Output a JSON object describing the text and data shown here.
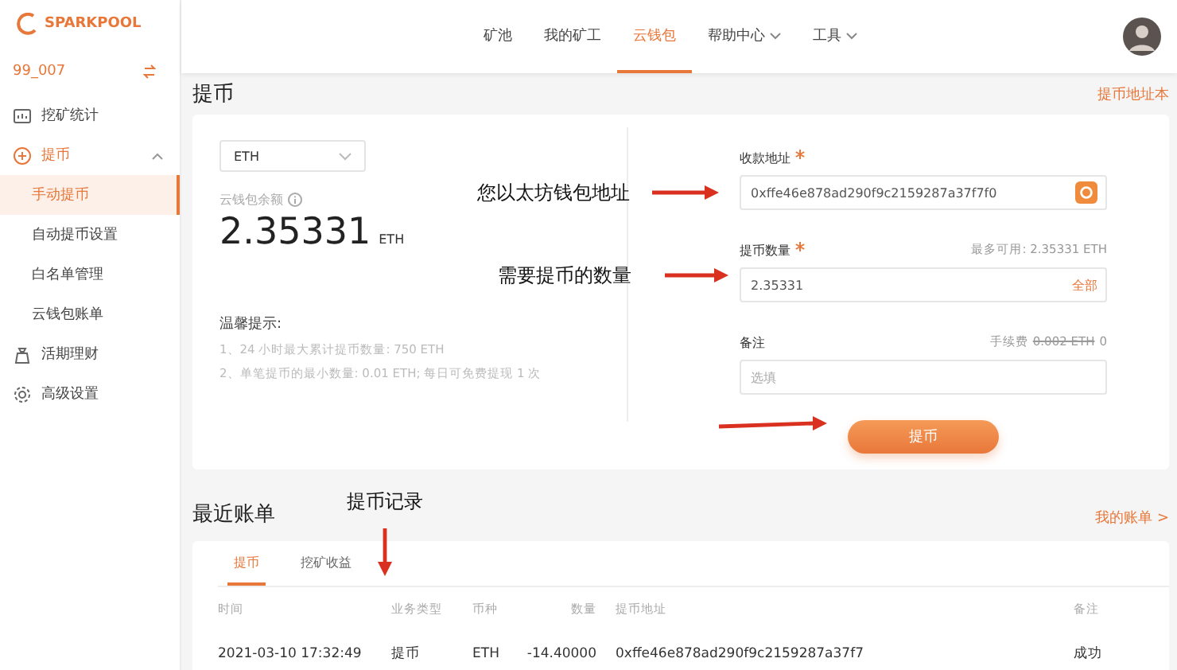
{
  "sidebar": {
    "logo": "SPARKPOOL",
    "user": "99_007",
    "items": [
      {
        "label": "挖矿统计"
      },
      {
        "label": "提币",
        "expanded": true,
        "children": [
          {
            "label": "手动提币",
            "selected": true
          },
          {
            "label": "自动提币设置",
            "selected": false
          },
          {
            "label": "白名单管理",
            "selected": false
          },
          {
            "label": "云钱包账单",
            "selected": false
          }
        ]
      },
      {
        "label": "活期理财"
      },
      {
        "label": "高级设置"
      }
    ]
  },
  "nav": [
    {
      "label": "矿池",
      "selected": false,
      "dropdown": false
    },
    {
      "label": "我的矿工",
      "selected": false,
      "dropdown": false
    },
    {
      "label": "云钱包",
      "selected": true,
      "dropdown": false
    },
    {
      "label": "帮助中心",
      "selected": false,
      "dropdown": true
    },
    {
      "label": "工具",
      "selected": false,
      "dropdown": true
    }
  ],
  "page": {
    "title": "提币",
    "link": "提币地址本"
  },
  "withdraw": {
    "coin": "ETH",
    "balance_label": "云钱包余额",
    "balance": "2.35331",
    "balance_unit": "ETH",
    "tips_title": "温馨提示:",
    "tips": [
      "1、24 小时最大累计提币数量: 750 ETH",
      "2、单笔提币的最小数量: 0.01 ETH; 每日可免费提现 1 次"
    ],
    "address": {
      "label": "收款地址",
      "required": true,
      "value": "0xffe46e878ad290f9c2159287a37f7f0"
    },
    "amount": {
      "label": "提币数量",
      "required": true,
      "hint": "最多可用: 2.35331 ETH",
      "value": "2.35331",
      "action": "全部"
    },
    "note": {
      "label": "备注",
      "required": false,
      "fee_label": "手续费",
      "fee_original": "0.002 ETH",
      "fee": "0",
      "placeholder": "选填"
    },
    "submit": "提币"
  },
  "annotations": [
    {
      "text": "您以太坊钱包地址"
    },
    {
      "text": "需要提币的数量"
    },
    {
      "text": "提币记录"
    }
  ],
  "recent": {
    "title": "最近账单",
    "link": "我的账单 >",
    "tabs": [
      {
        "label": "提币",
        "selected": true
      },
      {
        "label": "挖矿收益",
        "selected": false
      }
    ],
    "columns": [
      "时间",
      "业务类型",
      "币种",
      "数量",
      "提币地址",
      "备注"
    ],
    "rows": [
      [
        "2021-03-10 17:32:49",
        "提币",
        "ETH",
        "-14.40000",
        "0xffe46e878ad290f9c2159287a37f7",
        "成功"
      ]
    ]
  }
}
